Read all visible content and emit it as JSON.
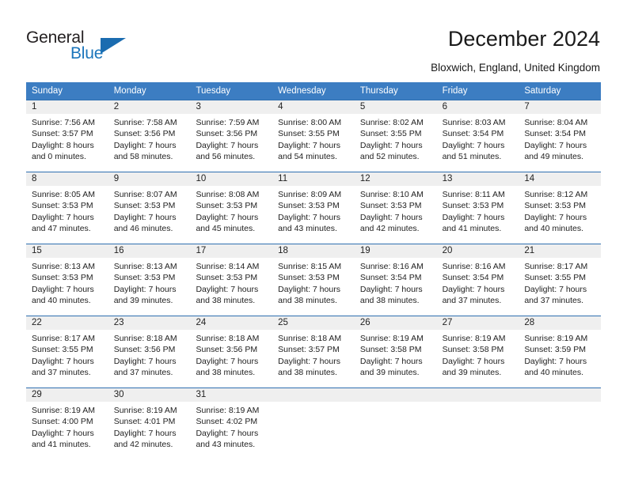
{
  "brand": {
    "word_one": "General",
    "word_two": "Blue",
    "triangle_color": "#1b6cb0",
    "blue_color": "#1b75bb"
  },
  "header": {
    "title": "December 2024",
    "location": "Bloxwich, England, United Kingdom"
  },
  "theme": {
    "header_blue": "#3c7dc2",
    "row_divider_blue": "#2f6fb0",
    "daynum_band": "#efefef"
  },
  "weekday_headers": [
    "Sunday",
    "Monday",
    "Tuesday",
    "Wednesday",
    "Thursday",
    "Friday",
    "Saturday"
  ],
  "weeks": [
    {
      "days": [
        {
          "day": "1",
          "sunrise": "Sunrise: 7:56 AM",
          "sunset": "Sunset: 3:57 PM",
          "daylight": "Daylight: 8 hours",
          "daylight2": "and 0 minutes."
        },
        {
          "day": "2",
          "sunrise": "Sunrise: 7:58 AM",
          "sunset": "Sunset: 3:56 PM",
          "daylight": "Daylight: 7 hours",
          "daylight2": "and 58 minutes."
        },
        {
          "day": "3",
          "sunrise": "Sunrise: 7:59 AM",
          "sunset": "Sunset: 3:56 PM",
          "daylight": "Daylight: 7 hours",
          "daylight2": "and 56 minutes."
        },
        {
          "day": "4",
          "sunrise": "Sunrise: 8:00 AM",
          "sunset": "Sunset: 3:55 PM",
          "daylight": "Daylight: 7 hours",
          "daylight2": "and 54 minutes."
        },
        {
          "day": "5",
          "sunrise": "Sunrise: 8:02 AM",
          "sunset": "Sunset: 3:55 PM",
          "daylight": "Daylight: 7 hours",
          "daylight2": "and 52 minutes."
        },
        {
          "day": "6",
          "sunrise": "Sunrise: 8:03 AM",
          "sunset": "Sunset: 3:54 PM",
          "daylight": "Daylight: 7 hours",
          "daylight2": "and 51 minutes."
        },
        {
          "day": "7",
          "sunrise": "Sunrise: 8:04 AM",
          "sunset": "Sunset: 3:54 PM",
          "daylight": "Daylight: 7 hours",
          "daylight2": "and 49 minutes."
        }
      ]
    },
    {
      "days": [
        {
          "day": "8",
          "sunrise": "Sunrise: 8:05 AM",
          "sunset": "Sunset: 3:53 PM",
          "daylight": "Daylight: 7 hours",
          "daylight2": "and 47 minutes."
        },
        {
          "day": "9",
          "sunrise": "Sunrise: 8:07 AM",
          "sunset": "Sunset: 3:53 PM",
          "daylight": "Daylight: 7 hours",
          "daylight2": "and 46 minutes."
        },
        {
          "day": "10",
          "sunrise": "Sunrise: 8:08 AM",
          "sunset": "Sunset: 3:53 PM",
          "daylight": "Daylight: 7 hours",
          "daylight2": "and 45 minutes."
        },
        {
          "day": "11",
          "sunrise": "Sunrise: 8:09 AM",
          "sunset": "Sunset: 3:53 PM",
          "daylight": "Daylight: 7 hours",
          "daylight2": "and 43 minutes."
        },
        {
          "day": "12",
          "sunrise": "Sunrise: 8:10 AM",
          "sunset": "Sunset: 3:53 PM",
          "daylight": "Daylight: 7 hours",
          "daylight2": "and 42 minutes."
        },
        {
          "day": "13",
          "sunrise": "Sunrise: 8:11 AM",
          "sunset": "Sunset: 3:53 PM",
          "daylight": "Daylight: 7 hours",
          "daylight2": "and 41 minutes."
        },
        {
          "day": "14",
          "sunrise": "Sunrise: 8:12 AM",
          "sunset": "Sunset: 3:53 PM",
          "daylight": "Daylight: 7 hours",
          "daylight2": "and 40 minutes."
        }
      ]
    },
    {
      "days": [
        {
          "day": "15",
          "sunrise": "Sunrise: 8:13 AM",
          "sunset": "Sunset: 3:53 PM",
          "daylight": "Daylight: 7 hours",
          "daylight2": "and 40 minutes."
        },
        {
          "day": "16",
          "sunrise": "Sunrise: 8:13 AM",
          "sunset": "Sunset: 3:53 PM",
          "daylight": "Daylight: 7 hours",
          "daylight2": "and 39 minutes."
        },
        {
          "day": "17",
          "sunrise": "Sunrise: 8:14 AM",
          "sunset": "Sunset: 3:53 PM",
          "daylight": "Daylight: 7 hours",
          "daylight2": "and 38 minutes."
        },
        {
          "day": "18",
          "sunrise": "Sunrise: 8:15 AM",
          "sunset": "Sunset: 3:53 PM",
          "daylight": "Daylight: 7 hours",
          "daylight2": "and 38 minutes."
        },
        {
          "day": "19",
          "sunrise": "Sunrise: 8:16 AM",
          "sunset": "Sunset: 3:54 PM",
          "daylight": "Daylight: 7 hours",
          "daylight2": "and 38 minutes."
        },
        {
          "day": "20",
          "sunrise": "Sunrise: 8:16 AM",
          "sunset": "Sunset: 3:54 PM",
          "daylight": "Daylight: 7 hours",
          "daylight2": "and 37 minutes."
        },
        {
          "day": "21",
          "sunrise": "Sunrise: 8:17 AM",
          "sunset": "Sunset: 3:55 PM",
          "daylight": "Daylight: 7 hours",
          "daylight2": "and 37 minutes."
        }
      ]
    },
    {
      "days": [
        {
          "day": "22",
          "sunrise": "Sunrise: 8:17 AM",
          "sunset": "Sunset: 3:55 PM",
          "daylight": "Daylight: 7 hours",
          "daylight2": "and 37 minutes."
        },
        {
          "day": "23",
          "sunrise": "Sunrise: 8:18 AM",
          "sunset": "Sunset: 3:56 PM",
          "daylight": "Daylight: 7 hours",
          "daylight2": "and 37 minutes."
        },
        {
          "day": "24",
          "sunrise": "Sunrise: 8:18 AM",
          "sunset": "Sunset: 3:56 PM",
          "daylight": "Daylight: 7 hours",
          "daylight2": "and 38 minutes."
        },
        {
          "day": "25",
          "sunrise": "Sunrise: 8:18 AM",
          "sunset": "Sunset: 3:57 PM",
          "daylight": "Daylight: 7 hours",
          "daylight2": "and 38 minutes."
        },
        {
          "day": "26",
          "sunrise": "Sunrise: 8:19 AM",
          "sunset": "Sunset: 3:58 PM",
          "daylight": "Daylight: 7 hours",
          "daylight2": "and 39 minutes."
        },
        {
          "day": "27",
          "sunrise": "Sunrise: 8:19 AM",
          "sunset": "Sunset: 3:58 PM",
          "daylight": "Daylight: 7 hours",
          "daylight2": "and 39 minutes."
        },
        {
          "day": "28",
          "sunrise": "Sunrise: 8:19 AM",
          "sunset": "Sunset: 3:59 PM",
          "daylight": "Daylight: 7 hours",
          "daylight2": "and 40 minutes."
        }
      ]
    },
    {
      "days": [
        {
          "day": "29",
          "sunrise": "Sunrise: 8:19 AM",
          "sunset": "Sunset: 4:00 PM",
          "daylight": "Daylight: 7 hours",
          "daylight2": "and 41 minutes."
        },
        {
          "day": "30",
          "sunrise": "Sunrise: 8:19 AM",
          "sunset": "Sunset: 4:01 PM",
          "daylight": "Daylight: 7 hours",
          "daylight2": "and 42 minutes."
        },
        {
          "day": "31",
          "sunrise": "Sunrise: 8:19 AM",
          "sunset": "Sunset: 4:02 PM",
          "daylight": "Daylight: 7 hours",
          "daylight2": "and 43 minutes."
        },
        {
          "day": "",
          "sunrise": "",
          "sunset": "",
          "daylight": "",
          "daylight2": ""
        },
        {
          "day": "",
          "sunrise": "",
          "sunset": "",
          "daylight": "",
          "daylight2": ""
        },
        {
          "day": "",
          "sunrise": "",
          "sunset": "",
          "daylight": "",
          "daylight2": ""
        },
        {
          "day": "",
          "sunrise": "",
          "sunset": "",
          "daylight": "",
          "daylight2": ""
        }
      ]
    }
  ]
}
